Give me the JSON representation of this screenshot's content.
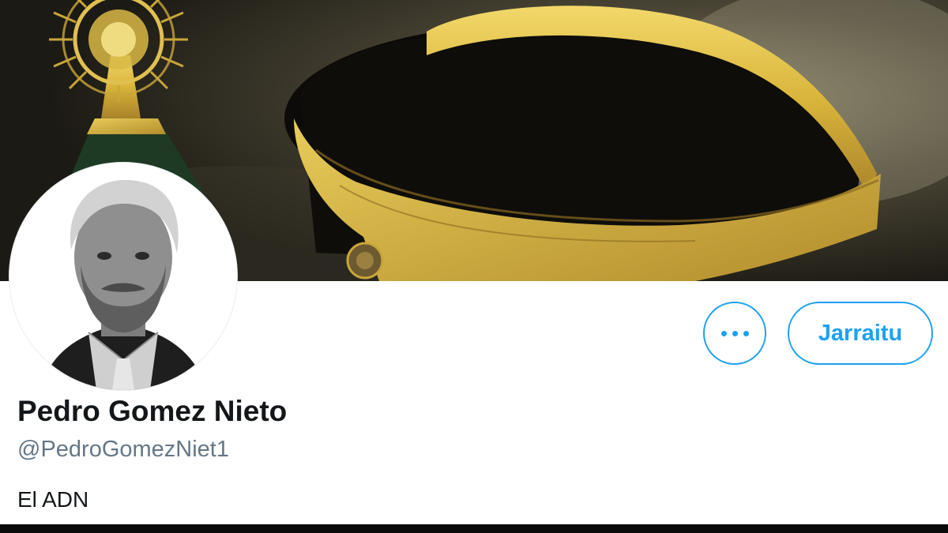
{
  "profile": {
    "display_name": "Pedro Gomez Nieto",
    "handle": "@PedroGomezNiet1",
    "bio": "El ADN"
  },
  "actions": {
    "more_icon": "more-horizontal-icon",
    "follow_label": "Jarraitu"
  },
  "colors": {
    "accent": "#1da1f2",
    "name_text": "#14171a",
    "handle_text": "#657786"
  }
}
